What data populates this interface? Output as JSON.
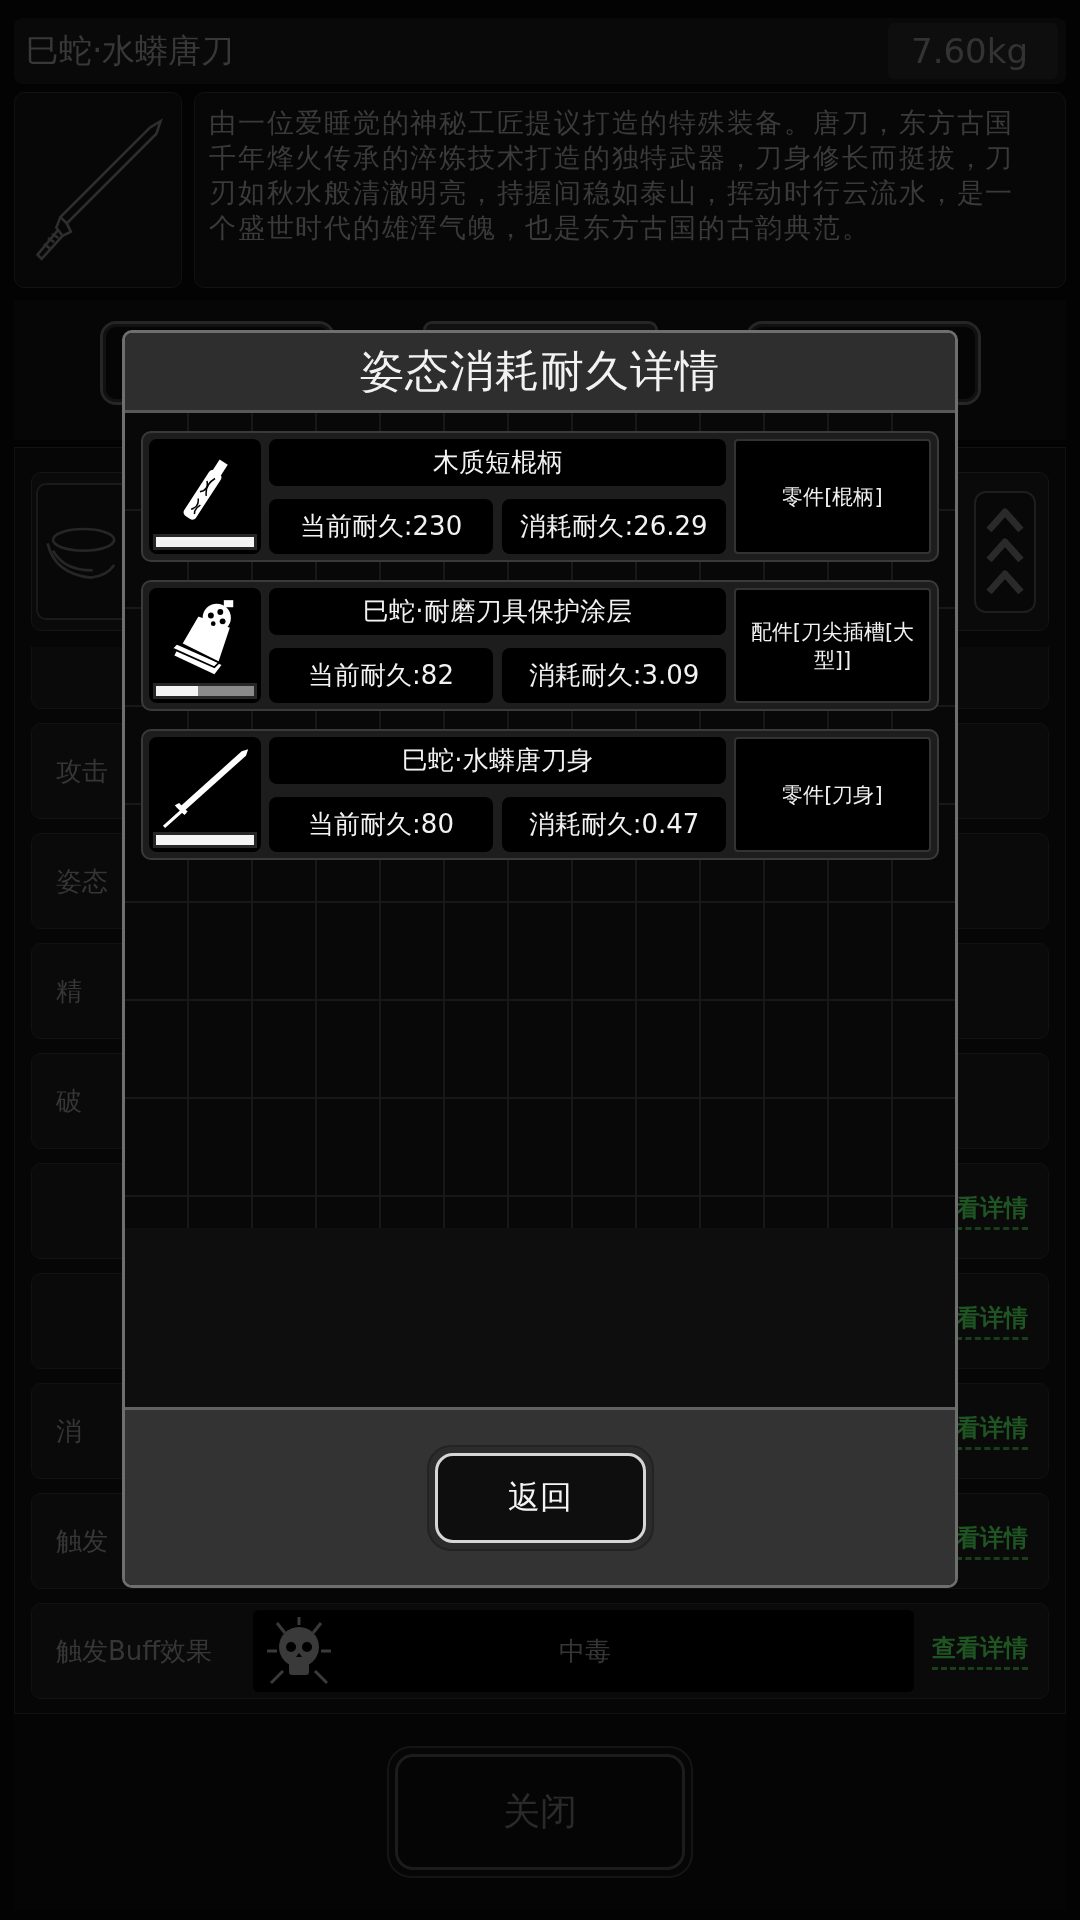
{
  "item": {
    "name": "巳蛇·水蟒唐刀",
    "weight": "7.60kg",
    "description": "由一位爱睡觉的神秘工匠提议打造的特殊装备。唐刀，东方古国千年烽火传承的淬炼技术打造的独特武器，刀身修长而挺拔，刀刃如秋水般清澈明亮，持握间稳如泰山，挥动时行云流水，是一个盛世时代的雄浑气魄，也是东方古国的古韵典范。"
  },
  "attribute_rows": [
    {
      "kind": "plain"
    },
    {
      "kind": "plain",
      "label": "攻击"
    },
    {
      "kind": "plain",
      "label": "姿态"
    },
    {
      "kind": "plain",
      "label": "精"
    },
    {
      "kind": "plain",
      "label": "破"
    },
    {
      "kind": "plain",
      "link": "看详情"
    },
    {
      "kind": "plain",
      "link": "看详情"
    },
    {
      "kind": "plain",
      "label": "消",
      "link": "看详情"
    },
    {
      "kind": "plain",
      "label": "触发",
      "link": "看详情"
    },
    {
      "kind": "buff",
      "label": "触发Buff效果",
      "value": "中毒",
      "link": "查看详情"
    }
  ],
  "close_button": "关闭",
  "dialog": {
    "title": "姿态消耗耐久详情",
    "parts": [
      {
        "kind": "handle",
        "name": "木质短棍柄",
        "current": "当前耐久:230",
        "consumed": "消耗耐久:26.29",
        "slot": "零件[棍柄]",
        "level": 1
      },
      {
        "kind": "coating",
        "name": "巳蛇·耐磨刀具保护涂层",
        "current": "当前耐久:82",
        "consumed": "消耗耐久:3.09",
        "slot": "配件[刀尖插槽[大型]]",
        "level": 0.43
      },
      {
        "kind": "blade",
        "name": "巳蛇·水蟒唐刀身",
        "current": "当前耐久:80",
        "consumed": "消耗耐久:0.47",
        "slot": "零件[刀身]",
        "level": 1
      }
    ],
    "back_button": "返回"
  }
}
